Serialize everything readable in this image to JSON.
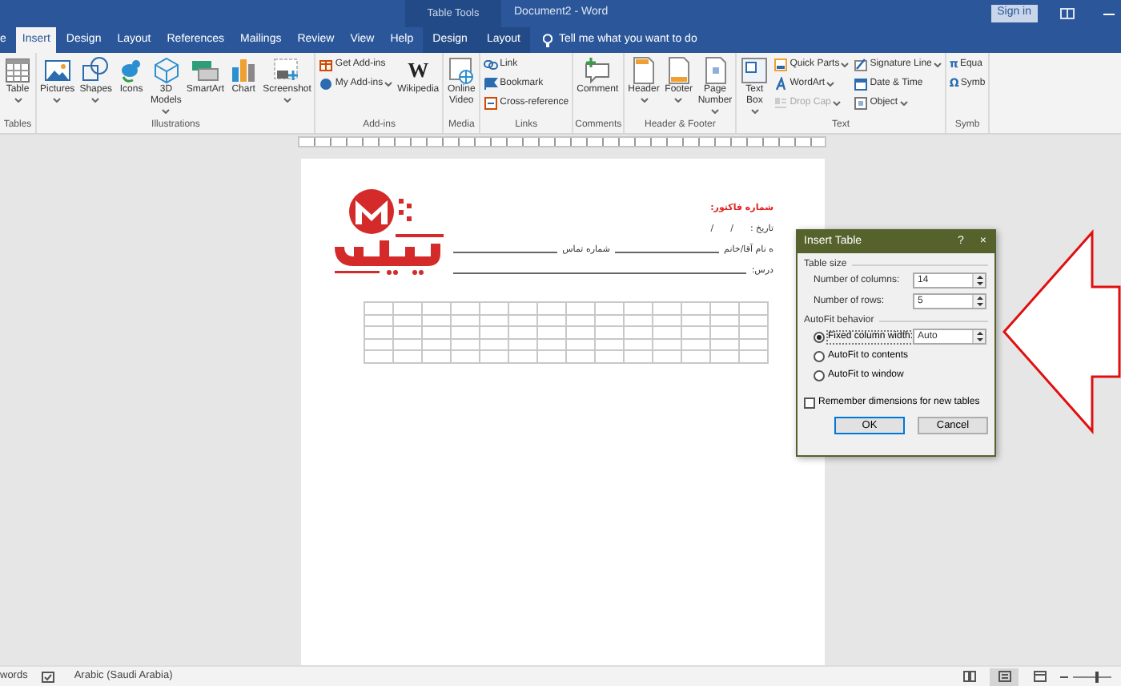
{
  "window": {
    "context_title": "Table Tools",
    "title": "Document2 - Word",
    "sign_in": "Sign in"
  },
  "tabs": [
    {
      "label": "e",
      "selected": false,
      "contextual": false
    },
    {
      "label": "Insert",
      "selected": true,
      "contextual": false
    },
    {
      "label": "Design",
      "selected": false,
      "contextual": false
    },
    {
      "label": "Layout",
      "selected": false,
      "contextual": false
    },
    {
      "label": "References",
      "selected": false,
      "contextual": false
    },
    {
      "label": "Mailings",
      "selected": false,
      "contextual": false
    },
    {
      "label": "Review",
      "selected": false,
      "contextual": false
    },
    {
      "label": "View",
      "selected": false,
      "contextual": false
    },
    {
      "label": "Help",
      "selected": false,
      "contextual": false
    },
    {
      "label": "Design",
      "selected": false,
      "contextual": true
    },
    {
      "label": "Layout",
      "selected": false,
      "contextual": true
    }
  ],
  "tell_me": "Tell me what you want to do",
  "ribbon": [
    {
      "name": "Tables",
      "items": [
        {
          "kind": "large",
          "label": "Table",
          "dropdown": true,
          "disabled": false
        }
      ]
    },
    {
      "name": "Illustrations",
      "items": [
        {
          "kind": "large",
          "label": "Pictures",
          "dropdown": true,
          "disabled": false
        },
        {
          "kind": "large",
          "label": "Shapes",
          "dropdown": true,
          "disabled": false
        },
        {
          "kind": "large",
          "label": "Icons",
          "dropdown": false,
          "disabled": false
        },
        {
          "kind": "large",
          "label": "3D\nModels",
          "dropdown": true,
          "disabled": false
        },
        {
          "kind": "large",
          "label": "SmartArt",
          "dropdown": false,
          "disabled": false
        },
        {
          "kind": "large",
          "label": "Chart",
          "dropdown": false,
          "disabled": false
        },
        {
          "kind": "large",
          "label": "Screenshot",
          "dropdown": true,
          "disabled": false
        }
      ]
    },
    {
      "name": "Add-ins",
      "items": [
        {
          "kind": "small",
          "label": "Get Add-ins",
          "dropdown": false,
          "disabled": false
        },
        {
          "kind": "small",
          "label": "My Add-ins",
          "dropdown": true,
          "disabled": false
        },
        {
          "kind": "large",
          "label": "Wikipedia",
          "glyph": "W",
          "dropdown": false,
          "disabled": false
        }
      ]
    },
    {
      "name": "Media",
      "items": [
        {
          "kind": "large",
          "label": "Online\nVideo",
          "dropdown": false,
          "disabled": false
        }
      ]
    },
    {
      "name": "Links",
      "items": [
        {
          "kind": "small",
          "label": "Link",
          "dropdown": false,
          "disabled": false
        },
        {
          "kind": "small",
          "label": "Bookmark",
          "dropdown": false,
          "disabled": false
        },
        {
          "kind": "small",
          "label": "Cross-reference",
          "dropdown": false,
          "disabled": false
        }
      ]
    },
    {
      "name": "Comments",
      "items": [
        {
          "kind": "large",
          "label": "Comment",
          "dropdown": false,
          "disabled": false
        }
      ]
    },
    {
      "name": "Header & Footer",
      "items": [
        {
          "kind": "large",
          "label": "Header",
          "dropdown": true,
          "disabled": false
        },
        {
          "kind": "large",
          "label": "Footer",
          "dropdown": true,
          "disabled": false
        },
        {
          "kind": "large",
          "label": "Page\nNumber",
          "dropdown": true,
          "disabled": false
        }
      ]
    },
    {
      "name": "Text",
      "items": [
        {
          "kind": "large",
          "label": "Text\nBox",
          "dropdown": true,
          "disabled": false
        },
        {
          "kind": "small",
          "label": "Quick Parts",
          "dropdown": true,
          "disabled": false
        },
        {
          "kind": "small",
          "label": "WordArt",
          "dropdown": true,
          "disabled": false
        },
        {
          "kind": "small",
          "label": "Drop Cap",
          "dropdown": true,
          "disabled": true
        },
        {
          "kind": "small",
          "label": "Signature Line",
          "dropdown": true,
          "disabled": false
        },
        {
          "kind": "small",
          "label": "Date & Time",
          "dropdown": false,
          "disabled": false
        },
        {
          "kind": "small",
          "label": "Object",
          "dropdown": true,
          "disabled": false
        }
      ]
    },
    {
      "name": "Symb",
      "items": [
        {
          "kind": "small",
          "label": "Equa",
          "glyph": "π",
          "dropdown": false,
          "disabled": false
        },
        {
          "kind": "small",
          "label": "Symb",
          "glyph": "Ω",
          "dropdown": false,
          "disabled": false
        }
      ]
    }
  ],
  "document": {
    "lines": [
      {
        "kind": "title",
        "labels": [
          "شماره فاکتور:"
        ]
      },
      {
        "kind": "date",
        "labels": [
          "تاریخ :      /      /"
        ]
      },
      {
        "kind": "fields",
        "labels": [
          "ه نام آقا/خانم",
          "شماره تماس"
        ]
      },
      {
        "kind": "address",
        "labels": [
          "درس:"
        ]
      }
    ]
  },
  "dialog": {
    "title": "Insert Table",
    "help": "?",
    "close": "×",
    "size_heading": "Table size",
    "fields": [
      {
        "label": "Number of columns:",
        "value": "14"
      },
      {
        "label": "Number of rows:",
        "value": "5"
      }
    ],
    "autofit_heading": "AutoFit behavior",
    "options": [
      {
        "label": "Fixed column width:",
        "selected": true,
        "value": "Auto"
      },
      {
        "label": "AutoFit to contents",
        "selected": false
      },
      {
        "label": "AutoFit to window",
        "selected": false
      }
    ],
    "remember": {
      "label": "Remember dimensions for new tables",
      "checked": false
    },
    "buttons": [
      "OK",
      "Cancel"
    ]
  },
  "status_bar": {
    "words": "words",
    "language": "Arabic (Saudi Arabia)",
    "views": [
      {
        "selected": false
      },
      {
        "selected": true
      },
      {
        "selected": false
      }
    ],
    "zoom": {
      "level": 0.6
    }
  }
}
